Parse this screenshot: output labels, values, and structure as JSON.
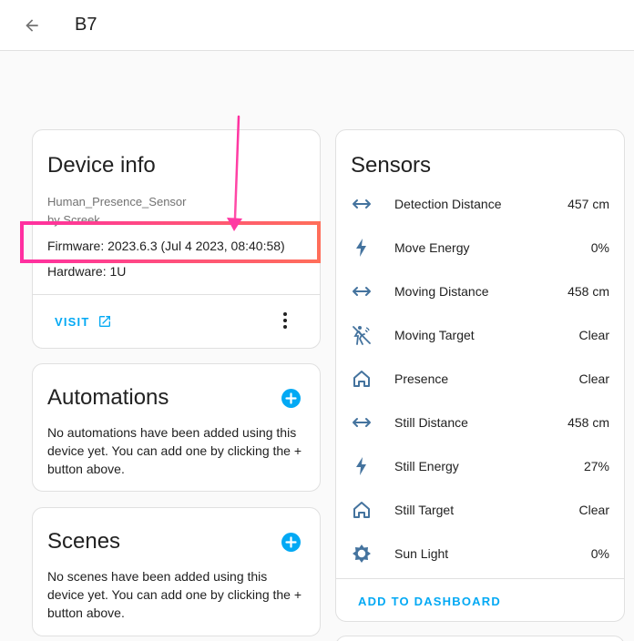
{
  "header": {
    "title": "B7"
  },
  "device_info": {
    "title": "Device info",
    "model": "Human_Presence_Sensor",
    "manufacturer": "by Screek",
    "firmware": "Firmware: 2023.6.3 (Jul 4 2023, 08:40:58)",
    "hardware": "Hardware: 1U",
    "visit_label": "VISIT"
  },
  "automations": {
    "title": "Automations",
    "text": "No automations have been added using this device yet. You can add one by clicking the + button above."
  },
  "scenes": {
    "title": "Scenes",
    "text": "No scenes have been added using this device yet. You can add one by clicking the + button above."
  },
  "sensors": {
    "title": "Sensors",
    "items": [
      {
        "name": "Detection Distance",
        "value": "457 cm",
        "icon": "arrow-left-right-icon"
      },
      {
        "name": "Move Energy",
        "value": "0%",
        "icon": "lightning-bolt-icon"
      },
      {
        "name": "Moving Distance",
        "value": "458 cm",
        "icon": "arrow-left-right-icon"
      },
      {
        "name": "Moving Target",
        "value": "Clear",
        "icon": "motion-sensor-off-icon"
      },
      {
        "name": "Presence",
        "value": "Clear",
        "icon": "home-outline-icon"
      },
      {
        "name": "Still Distance",
        "value": "458 cm",
        "icon": "arrow-left-right-icon"
      },
      {
        "name": "Still Energy",
        "value": "27%",
        "icon": "lightning-bolt-icon"
      },
      {
        "name": "Still Target",
        "value": "Clear",
        "icon": "home-outline-icon"
      },
      {
        "name": "Sun Light",
        "value": "0%",
        "icon": "brightness-icon"
      }
    ],
    "add_to_dashboard_label": "ADD TO DASHBOARD"
  },
  "colors": {
    "accent": "#03a9f4",
    "icon": "#44739e",
    "annotation_start": "#ff2fa0",
    "annotation_end": "#ff6e5a"
  }
}
